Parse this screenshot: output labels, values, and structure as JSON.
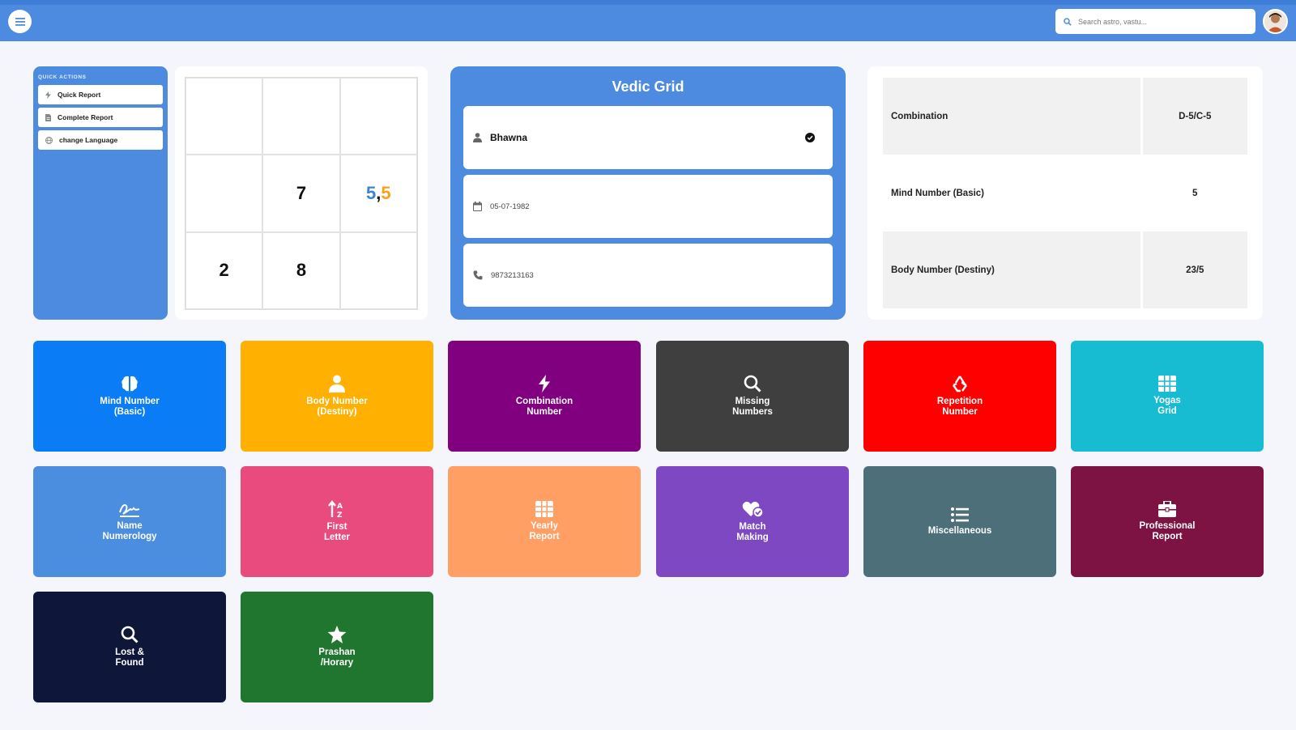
{
  "header": {
    "search_placeholder": "Search astro, vastu..."
  },
  "quick_actions": {
    "title": "QUICK ACTIONS",
    "items": [
      {
        "label": "Quick Report",
        "icon": "bolt-icon"
      },
      {
        "label": "Complete Report",
        "icon": "document-icon"
      },
      {
        "label": "change Language",
        "icon": "globe-icon"
      }
    ]
  },
  "loshu_grid": {
    "row1": [
      "",
      "",
      ""
    ],
    "row2": [
      "",
      "7",
      "5,5"
    ],
    "row3": [
      "2",
      "8",
      ""
    ],
    "split_cell": {
      "first": "5",
      "separator": ",",
      "second": "5",
      "first_color": "#3b82d6",
      "second_color": "#f7a21b"
    }
  },
  "vedic": {
    "title": "Vedic Grid",
    "name": "Bhawna",
    "dob": "05-07-1982",
    "phone": "9873213163"
  },
  "combination_table": {
    "rows": [
      {
        "label": "Combination",
        "value": "D-5/C-5"
      },
      {
        "label": "Mind Number (Basic)",
        "value": "5"
      },
      {
        "label": "Body Number (Destiny)",
        "value": "23/5"
      }
    ]
  },
  "tiles": [
    {
      "line1": "Mind Number",
      "line2": "(Basic)",
      "icon": "brain-icon",
      "color": "#0a7cf6"
    },
    {
      "line1": "Body Number",
      "line2": "(Destiny)",
      "icon": "person-icon",
      "color": "#ffb000"
    },
    {
      "line1": "Combination",
      "line2": "Number",
      "icon": "bolt-icon",
      "color": "#800080"
    },
    {
      "line1": "Missing",
      "line2": "Numbers",
      "icon": "search-icon",
      "color": "#3f3f3f"
    },
    {
      "line1": "Repetition",
      "line2": "Number",
      "icon": "recycle-icon",
      "color": "#ff0000"
    },
    {
      "line1": "Yogas",
      "line2": "Grid",
      "icon": "grid-icon",
      "color": "#17bcd2"
    },
    {
      "line1": "Name",
      "line2": "Numerology",
      "icon": "signature-icon",
      "color": "#4b8ee0"
    },
    {
      "line1": "First",
      "line2": "Letter",
      "icon": "sort-alpha-icon",
      "color": "#e94b7f"
    },
    {
      "line1": "Yearly",
      "line2": "Report",
      "icon": "table-icon",
      "color": "#ff9f63"
    },
    {
      "line1": "Match",
      "line2": "Making",
      "icon": "heart-check-icon",
      "color": "#7f48c3"
    },
    {
      "line1": "Miscellaneous",
      "line2": "",
      "icon": "list-icon",
      "color": "#4c6f79"
    },
    {
      "line1": "Professional",
      "line2": "Report",
      "icon": "briefcase-icon",
      "color": "#7d1342"
    },
    {
      "line1": "Lost &",
      "line2": "Found",
      "icon": "search-icon",
      "color": "#0e1739"
    },
    {
      "line1": "Prashan",
      "line2": "/Horary",
      "icon": "star-icon",
      "color": "#21762f"
    }
  ]
}
